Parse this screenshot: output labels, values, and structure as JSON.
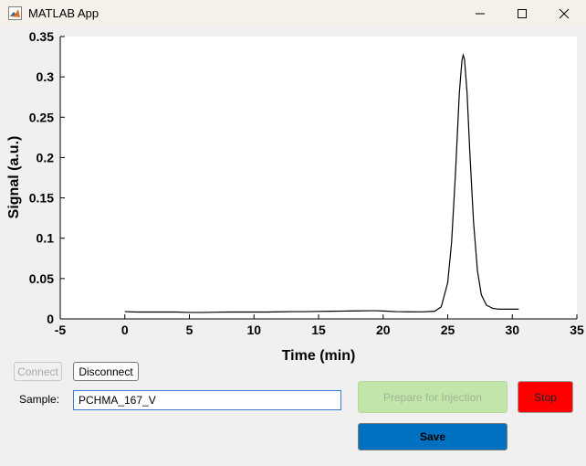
{
  "window": {
    "title": "MATLAB App",
    "icon": "matlab-logo-icon",
    "controls": [
      "minimize-icon",
      "maximize-icon",
      "close-icon"
    ]
  },
  "chart_data": {
    "type": "line",
    "title": "",
    "xlabel": "Time (min)",
    "ylabel": "Signal (a.u.)",
    "xlim": [
      -5,
      35
    ],
    "ylim": [
      0,
      0.35
    ],
    "xticks": [
      "-5",
      "0",
      "5",
      "10",
      "15",
      "20",
      "25",
      "30",
      "35"
    ],
    "yticks": [
      "0",
      "0.05",
      "0.1",
      "0.15",
      "0.2",
      "0.25",
      "0.3",
      "0.35"
    ],
    "grid": false,
    "series": [
      {
        "name": "",
        "color": "#000000",
        "x": [
          0,
          1,
          2,
          3,
          4,
          5,
          6,
          7,
          8,
          9,
          10,
          11,
          12,
          13,
          14,
          15,
          16,
          17,
          18,
          19,
          19.5,
          20,
          21,
          22,
          23,
          24,
          24.5,
          25,
          25.3,
          25.6,
          25.9,
          26.1,
          26.2,
          26.3,
          26.5,
          26.7,
          27,
          27.3,
          27.6,
          28,
          28.5,
          29,
          29.5,
          30,
          30.5
        ],
        "y": [
          0.009,
          0.0085,
          0.0085,
          0.0085,
          0.0085,
          0.008,
          0.008,
          0.0083,
          0.0085,
          0.0085,
          0.0085,
          0.0085,
          0.0088,
          0.009,
          0.009,
          0.0093,
          0.0095,
          0.0097,
          0.0099,
          0.0101,
          0.0101,
          0.0098,
          0.009,
          0.0088,
          0.0087,
          0.0095,
          0.015,
          0.045,
          0.095,
          0.18,
          0.28,
          0.32,
          0.327,
          0.322,
          0.28,
          0.21,
          0.12,
          0.06,
          0.03,
          0.017,
          0.013,
          0.012,
          0.012,
          0.012,
          0.012
        ]
      }
    ]
  },
  "controls": {
    "connect_label": "Connect",
    "disconnect_label": "Disconnect",
    "sample_label": "Sample:",
    "sample_value": "PCHMA_167_V",
    "prepare_label": "Prepare for Injection",
    "stop_label": "Stop",
    "save_label": "Save",
    "stop_color": "#ff0000",
    "save_color": "#0070c0",
    "prepare_color": "#c2e5a9"
  }
}
